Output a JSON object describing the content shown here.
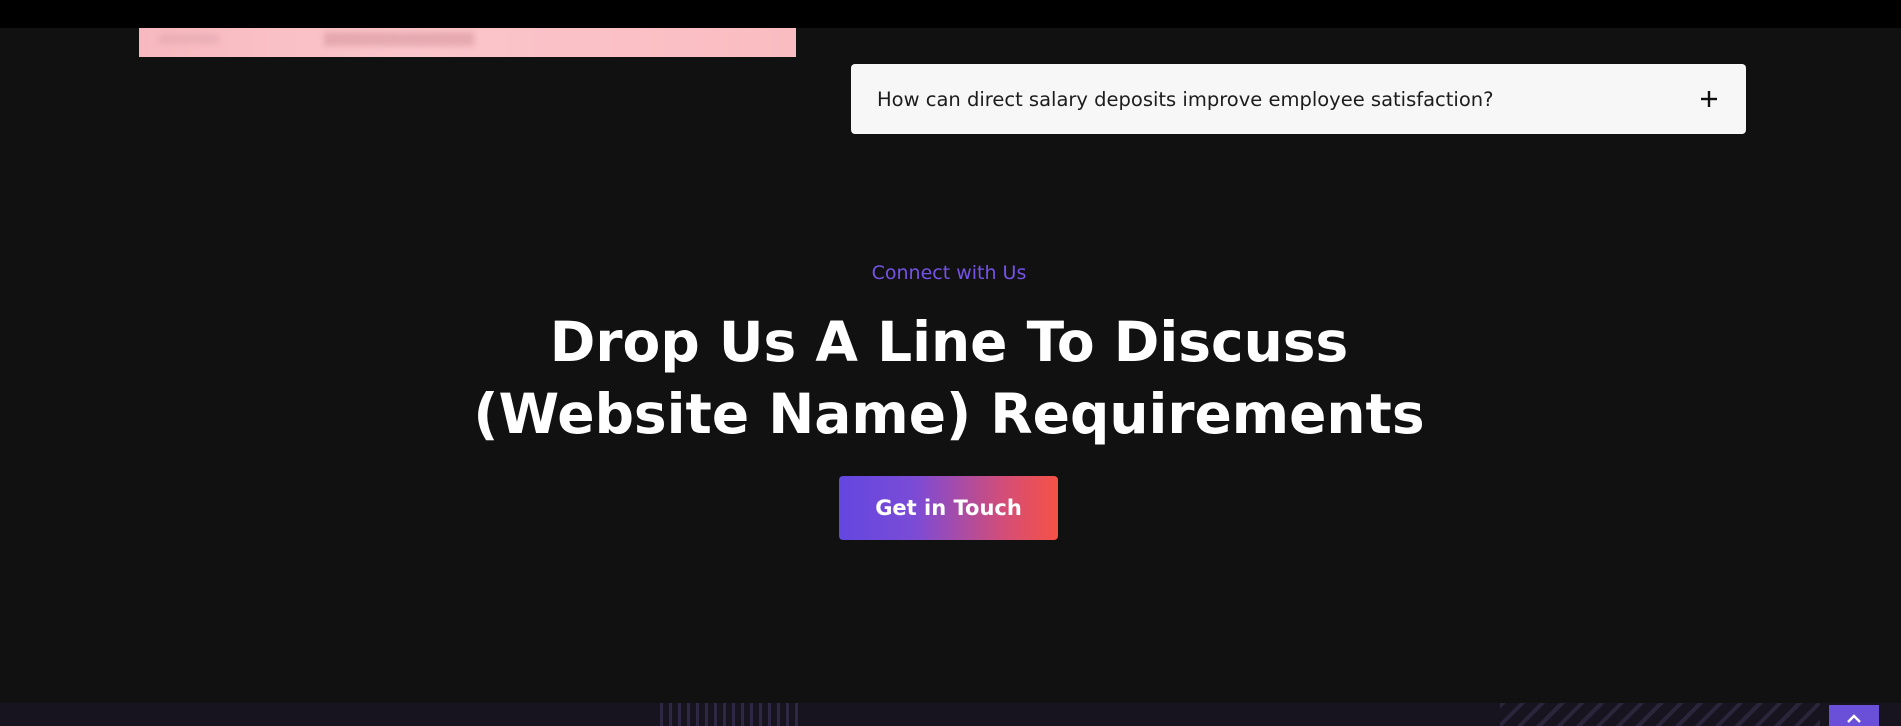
{
  "faq": {
    "question": "How can direct salary deposits improve employee satisfaction?",
    "expand_icon": "plus-icon"
  },
  "cta": {
    "eyebrow": "Connect with Us",
    "headline_line1": "Drop Us A Line To Discuss",
    "headline_line2": "(Website Name) Requirements",
    "button_label": "Get in Touch"
  },
  "scroll_top": {
    "icon": "chevron-up-icon"
  },
  "colors": {
    "page_background": "#111111",
    "top_bar": "#000000",
    "accent_purple": "#7553e6",
    "gradient_start": "#6347e0",
    "gradient_end": "#f65245",
    "faq_background": "#f7f7f7",
    "scroll_top_background": "#6a4fd9"
  }
}
